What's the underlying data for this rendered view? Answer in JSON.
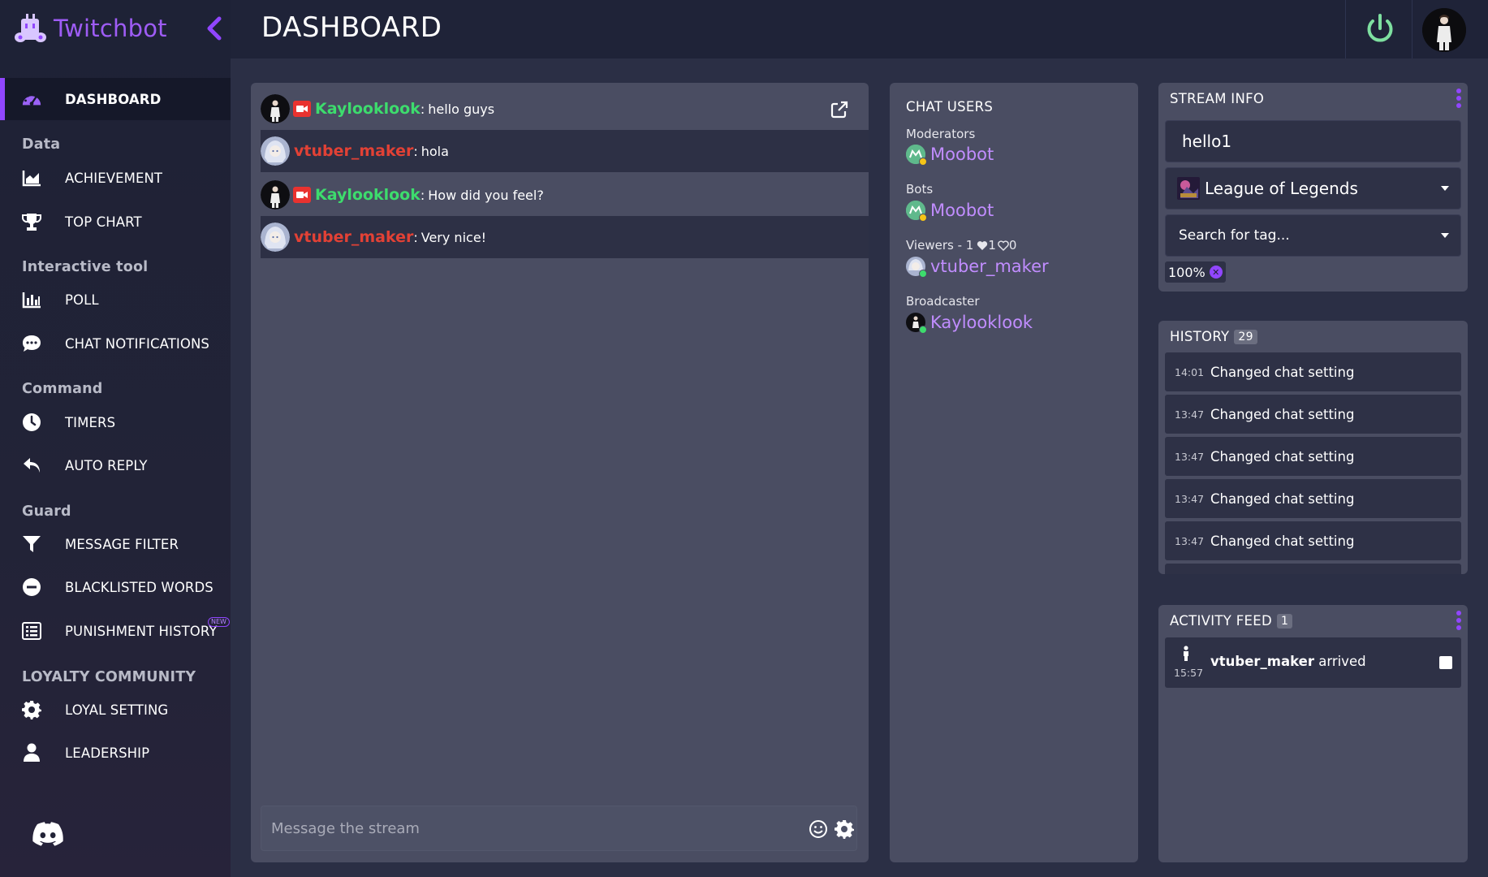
{
  "app": {
    "brand_name": "Twitchbot",
    "page_title": "DASHBOARD",
    "accent_color": "#9146ff"
  },
  "sidebar": {
    "items": [
      {
        "label": "DASHBOARD",
        "icon": "gauge-icon",
        "active": true
      },
      {
        "label": "ACHIEVEMENT",
        "icon": "area-chart-icon"
      },
      {
        "label": "TOP CHART",
        "icon": "trophy-icon"
      },
      {
        "label": "POLL",
        "icon": "bar-chart-icon"
      },
      {
        "label": "CHAT NOTIFICATIONS",
        "icon": "chat-bubble-icon"
      },
      {
        "label": "TIMERS",
        "icon": "clock-icon"
      },
      {
        "label": "AUTO REPLY",
        "icon": "reply-icon"
      },
      {
        "label": "MESSAGE FILTER",
        "icon": "filter-icon"
      },
      {
        "label": "BLACKLISTED WORDS",
        "icon": "minus-circle-icon"
      },
      {
        "label": "PUNISHMENT HISTORY",
        "icon": "list-icon",
        "badge": "NEW"
      },
      {
        "label": "LOYAL SETTING",
        "icon": "gear-icon"
      },
      {
        "label": "LEADERSHIP",
        "icon": "user-icon"
      }
    ],
    "sections": {
      "data": "Data",
      "interactive": "Interactive tool",
      "command": "Command",
      "guard": "Guard",
      "loyalty": "LOYALTY COMMUNITY"
    }
  },
  "chat": {
    "messages": [
      {
        "user": "Kaylooklook",
        "text": "hello guys",
        "color": "#3ddc6d",
        "broadcaster": true
      },
      {
        "user": "vtuber_maker",
        "text": "hola",
        "color": "#e24135",
        "broadcaster": false
      },
      {
        "user": "Kaylooklook",
        "text": "How did you feel?",
        "color": "#3ddc6d",
        "broadcaster": true
      },
      {
        "user": "vtuber_maker",
        "text": "Very nice!",
        "color": "#e24135",
        "broadcaster": false
      }
    ],
    "colon": ":",
    "input_placeholder": "Message the stream"
  },
  "users": {
    "title": "CHAT USERS",
    "groups": [
      {
        "label": "Moderators",
        "user": "Moobot",
        "status_color": "#f5c518"
      },
      {
        "label": "Bots",
        "user": "Moobot",
        "status_color": "#f5c518"
      },
      {
        "label": "Viewers - 1 ",
        "likes": "1",
        "hearts": "0",
        "user": "vtuber_maker",
        "status_color": "#3ddc6d"
      },
      {
        "label": "Broadcaster",
        "user": "Kaylooklook",
        "status_color": "#3ddc6d"
      }
    ]
  },
  "stream_info": {
    "title": "STREAM INFO",
    "stream_title": "hello1",
    "category": "League of Legends",
    "tag_placeholder": "Search for tag...",
    "tag_chip": "100%"
  },
  "history": {
    "title": "HISTORY",
    "count": "29",
    "rows": [
      {
        "time": "14:01",
        "desc": "Changed chat setting"
      },
      {
        "time": "13:47",
        "desc": "Changed chat setting"
      },
      {
        "time": "13:47",
        "desc": "Changed chat setting"
      },
      {
        "time": "13:47",
        "desc": "Changed chat setting"
      },
      {
        "time": "13:47",
        "desc": "Changed chat setting"
      }
    ]
  },
  "activity": {
    "title": "ACTIVITY FEED",
    "count": "1",
    "items": [
      {
        "user": "vtuber_maker",
        "action": " arrived",
        "time": "15:57"
      }
    ]
  }
}
